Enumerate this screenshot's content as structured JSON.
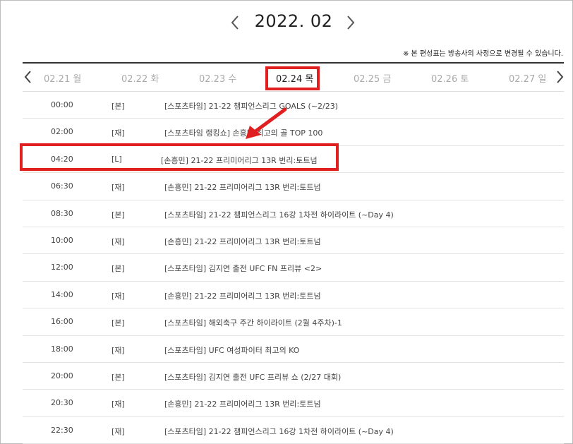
{
  "month": {
    "title": "2022. 02"
  },
  "notice": "※ 본 편성표는 방송사의 사정으로 변경될 수 있습니다.",
  "tabs": [
    {
      "label": "02.21 월",
      "active": false
    },
    {
      "label": "02.22 화",
      "active": false
    },
    {
      "label": "02.23 수",
      "active": false
    },
    {
      "label": "02.24 목",
      "active": true
    },
    {
      "label": "02.25 금",
      "active": false
    },
    {
      "label": "02.26 토",
      "active": false
    },
    {
      "label": "02.27 일",
      "active": false
    }
  ],
  "schedule": [
    {
      "time": "00:00",
      "type": "[본]",
      "title": "[스포츠타임] 21-22 챔피언스리그 GOALS (~2/23)"
    },
    {
      "time": "02:00",
      "type": "[재]",
      "title": "[스포츠타임 랭킹쇼] 손흥민 최고의 골 TOP 100"
    },
    {
      "time": "04:20",
      "type": "[L]",
      "title": "[손흥민] 21-22 프리미어리그 13R 번리:토트넘"
    },
    {
      "time": "06:30",
      "type": "[재]",
      "title": "[손흥민] 21-22 프리미어리그 13R 번리:토트넘"
    },
    {
      "time": "08:30",
      "type": "[본]",
      "title": "[스포츠타임] 21-22 챔피언스리그 16강 1차전 하이라이트 (~Day 4)"
    },
    {
      "time": "10:00",
      "type": "[재]",
      "title": "[손흥민] 21-22 프리미어리그 13R 번리:토트넘"
    },
    {
      "time": "12:00",
      "type": "[본]",
      "title": "[스포츠타임] 김지연 출전 UFC FN 프리뷰 <2>"
    },
    {
      "time": "14:00",
      "type": "[재]",
      "title": "[손흥민] 21-22 프리미어리그 13R 번리:토트넘"
    },
    {
      "time": "16:00",
      "type": "[본]",
      "title": "[스포츠타임] 해외축구 주간 하이라이트 (2월 4주차)-1"
    },
    {
      "time": "18:00",
      "type": "[재]",
      "title": "[스포츠타임] UFC 여성파이터 최고의 KO"
    },
    {
      "time": "20:00",
      "type": "[본]",
      "title": "[스포츠타임] 김지연 출전 UFC 프리뷰 쇼 (2/27 대회)"
    },
    {
      "time": "20:30",
      "type": "[재]",
      "title": "[손흥민] 21-22 프리미어리그 13R 번리:토트넘"
    },
    {
      "time": "22:30",
      "type": "[재]",
      "title": "[스포츠타임] 21-22 챔피언스리그 16강 1차전 하이라이트 (~Day 4)"
    }
  ],
  "colors": {
    "highlight": "#e02020",
    "active_text": "#222222",
    "inactive_text": "#aaaaaa"
  },
  "icons": {
    "month_prev": "chevron-left-icon",
    "month_next": "chevron-right-icon",
    "annotation": "red-arrow-icon"
  }
}
